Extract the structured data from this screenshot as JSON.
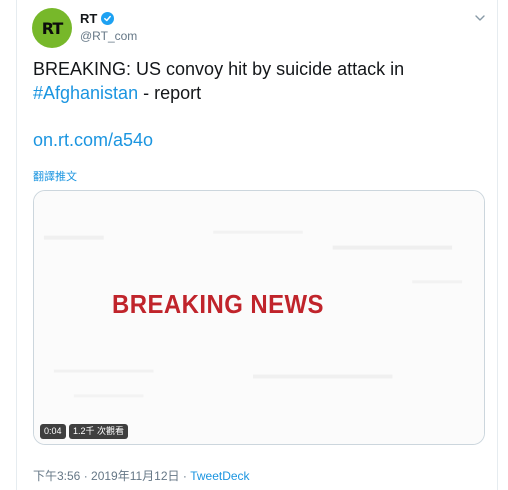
{
  "tweet": {
    "display_name": "RT",
    "handle": "@RT_com",
    "avatar_text": "RT",
    "text_part1": "BREAKING: US convoy hit by suicide attack in",
    "hashtag": "#Afghanistan",
    "text_part2": " - report",
    "link": "on.rt.com/a54o",
    "translate_label": "翻譯推文"
  },
  "media": {
    "headline": "BREAKING NEWS",
    "duration": "0:04",
    "views": "1.2千 次觀看"
  },
  "footer": {
    "timestamp": "下午3:56 · 2019年11月12日",
    "separator": " · ",
    "source": "TweetDeck"
  },
  "colors": {
    "accent": "#1b95e0",
    "verified": "#1da1f2",
    "avatar_bg": "#77b82a",
    "breaking_red": "#c0242b"
  },
  "icons": {
    "verified": "verified-badge-icon",
    "menu": "chevron-down-icon"
  }
}
